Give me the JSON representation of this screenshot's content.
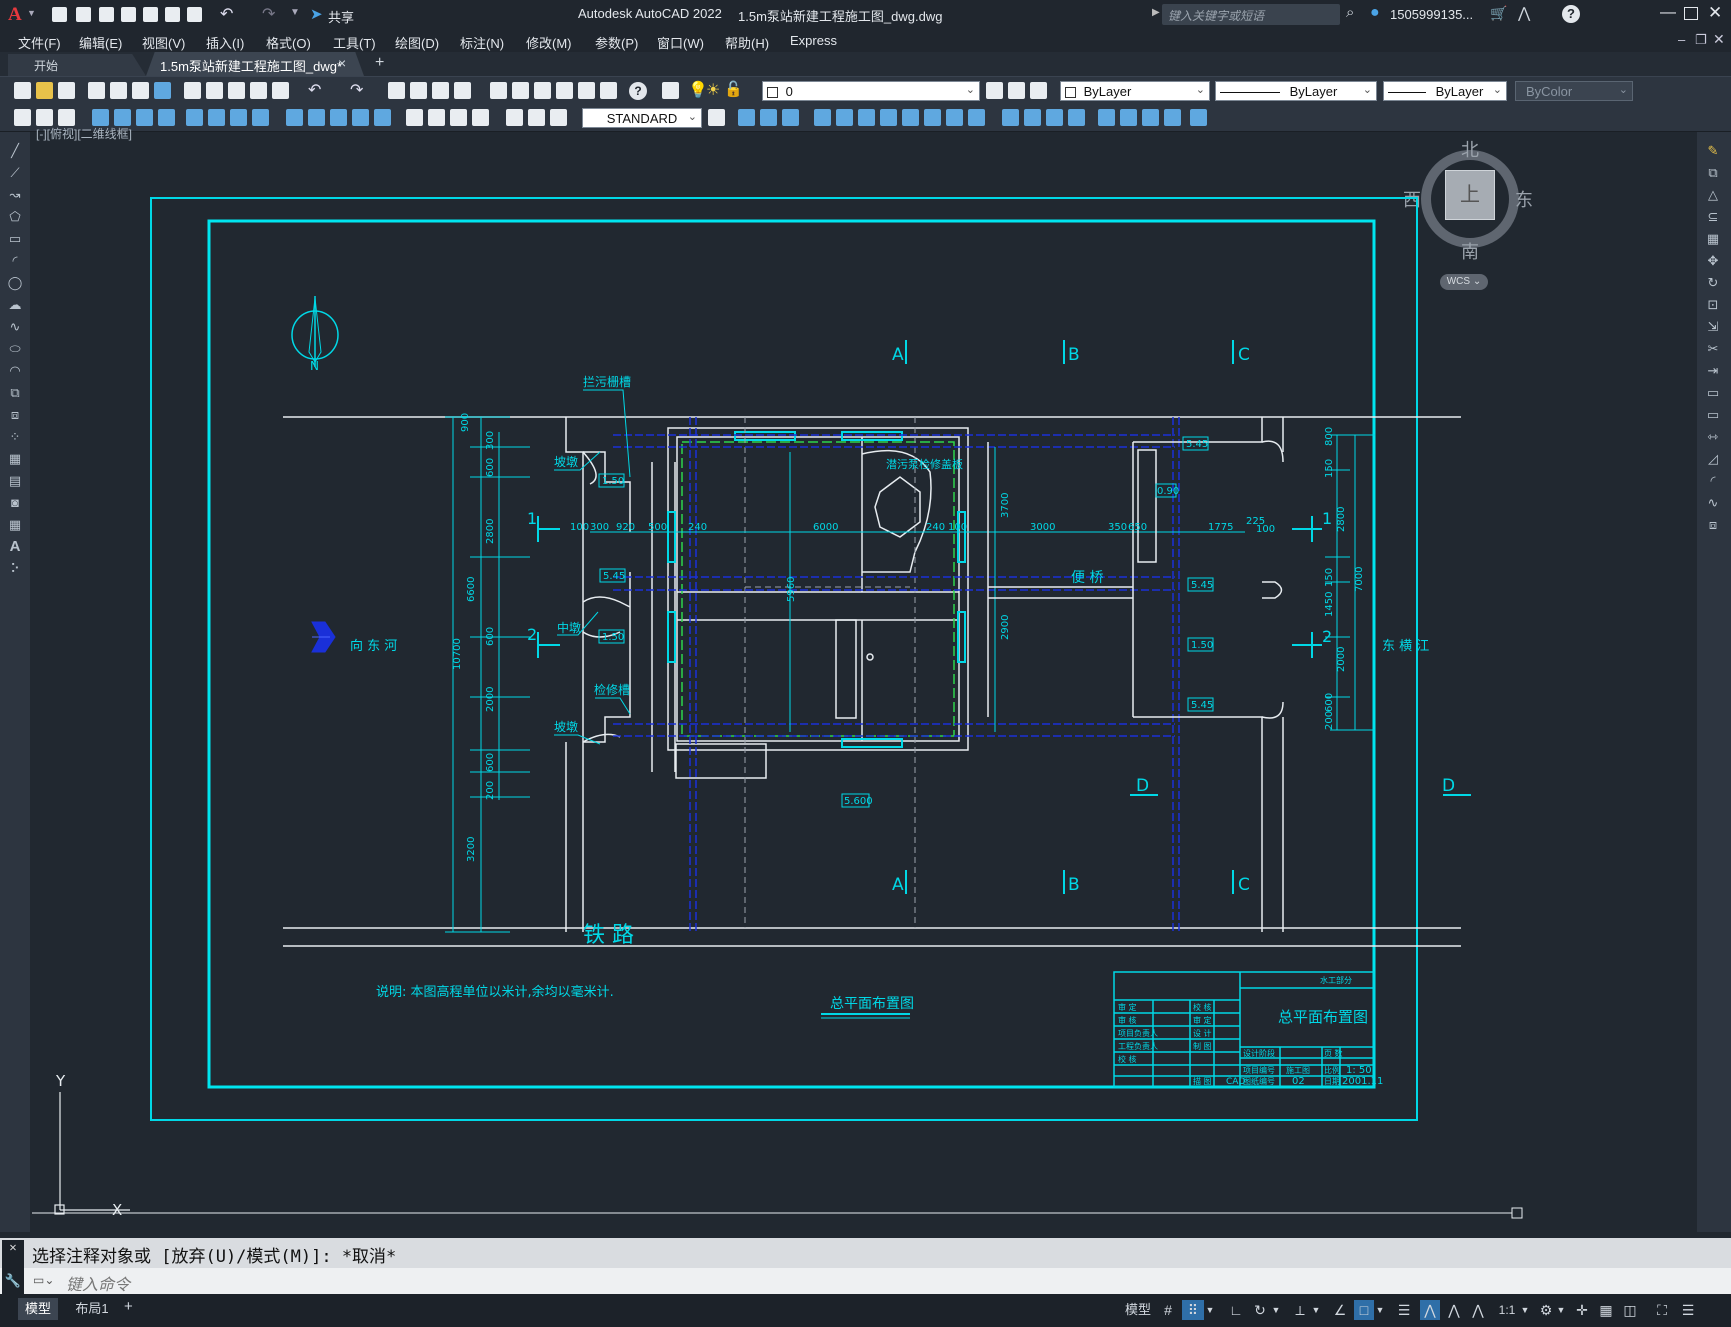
{
  "app": {
    "logo": "A",
    "title": "Autodesk AutoCAD 2022",
    "filename": "1.5m泵站新建工程施工图_dwg.dwg",
    "share_label": "共享",
    "search_placeholder": "键入关键字或短语",
    "user": "1505999135...",
    "help": "?"
  },
  "menu": [
    "文件(F)",
    "编辑(E)",
    "视图(V)",
    "插入(I)",
    "格式(O)",
    "工具(T)",
    "绘图(D)",
    "标注(N)",
    "修改(M)",
    "参数(P)",
    "窗口(W)",
    "帮助(H)",
    "Express"
  ],
  "tabs": {
    "start": "开始",
    "active": "1.5m泵站新建工程施工图_dwg*",
    "close": "×",
    "add": "+"
  },
  "toolbar": {
    "layer_value": "0",
    "text_style": "STANDARD",
    "color": "ByLayer",
    "linetype": "ByLayer",
    "lineweight": "ByLayer",
    "plotstyle": "ByColor"
  },
  "viewport_label": "[-][俯视][二维线框]",
  "viewcube": {
    "north": "北",
    "south": "南",
    "east": "东",
    "west": "西",
    "top": "上",
    "wcs": "WCS"
  },
  "drawing": {
    "north_label": "N",
    "sections_top": [
      "A",
      "B",
      "C"
    ],
    "sections_bottom": [
      "A",
      "B",
      "C"
    ],
    "section_d": [
      "D",
      "D"
    ],
    "section_numbers": [
      "1",
      "2",
      "1",
      "2"
    ],
    "labels": {
      "railway": "铁 路",
      "west_river": "向 东 河",
      "east_river": "东 横 江",
      "bridge": "便 桥",
      "lanhuicao": "拦污栅槽",
      "pobi1": "坡墩",
      "pobi2": "坡墩",
      "zhongdun": "中墩",
      "jianxiucao": "检修槽",
      "motor": "潜污泵检修盖板",
      "note": "说明: 本图高程单位以米计,余均以毫米计.",
      "plan_title": "总平面布置图"
    },
    "elevations": [
      "1.50",
      "1.50",
      "5.45",
      "5.45",
      "5.45",
      "5.45",
      "5.600",
      "1.50",
      "0.90"
    ],
    "dims_horizontal": [
      "100",
      "300",
      "920",
      "500",
      "240",
      "6000",
      "240",
      "100",
      "3000",
      "350",
      "650",
      "1775",
      "225",
      "100"
    ],
    "dims_left": [
      "900",
      "300",
      "600",
      "2800",
      "6600",
      "600",
      "2000",
      "600",
      "200",
      "10700",
      "3200"
    ],
    "dims_right": [
      "800",
      "150",
      "2800",
      "7000",
      "150",
      "1450",
      "2000",
      "600",
      "200"
    ],
    "dims_center": [
      "3700",
      "2900",
      "5960"
    ],
    "titleblock": {
      "company": "水工部分",
      "title": "总平面布置图",
      "scale_label": "比例",
      "scale": "1: 50",
      "date_label": "日期",
      "date": "2001.11",
      "drawing_no": "02",
      "cad": "CAD",
      "rows_left": [
        "审 定",
        "审 核",
        "项目负责人",
        "工程负责人",
        "校 核"
      ],
      "rows_mid": [
        "校 核",
        "审 定",
        "设 计",
        "制 图",
        "描 图"
      ],
      "rows_right_labels": [
        "设计阶段",
        "项目编号",
        "图纸编号"
      ],
      "stage": "施工图",
      "page_label": "页 数"
    }
  },
  "ucs": {
    "x": "X",
    "y": "Y"
  },
  "command": {
    "history": "选择注释对象或 [放弃(U)/模式(M)]: *取消*",
    "placeholder": "键入命令"
  },
  "layout_tabs": [
    "模型",
    "布局1",
    "+"
  ],
  "status": {
    "model": "模型",
    "scale": "1:1"
  }
}
